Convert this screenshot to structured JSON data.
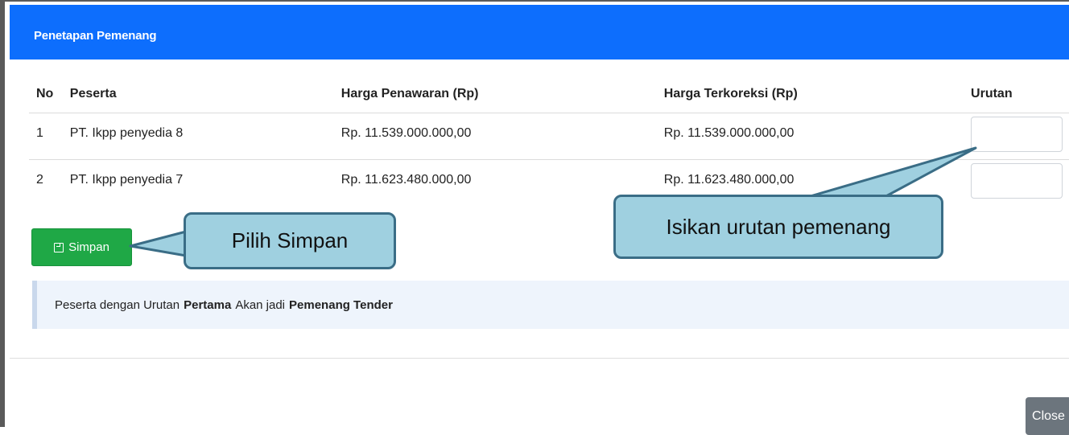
{
  "modal": {
    "title": "Penetapan Pemenang",
    "close_label": "Close"
  },
  "table": {
    "headers": {
      "no": "No",
      "peserta": "Peserta",
      "harga_penawaran": "Harga Penawaran (Rp)",
      "harga_terkoreksi": "Harga Terkoreksi (Rp)",
      "urutan": "Urutan"
    },
    "rows": [
      {
        "no": "1",
        "peserta": "PT. Ikpp penyedia 8",
        "harga_penawaran": "Rp. 11.539.000.000,00",
        "harga_terkoreksi": "Rp. 11.539.000.000,00",
        "urutan": ""
      },
      {
        "no": "2",
        "peserta": "PT. Ikpp penyedia 7",
        "harga_penawaran": "Rp. 11.623.480.000,00",
        "harga_terkoreksi": "Rp. 11.623.480.000,00",
        "urutan": ""
      }
    ]
  },
  "actions": {
    "simpan_label": "Simpan",
    "simpan_icon": "save-icon"
  },
  "info": {
    "part1": "Peserta dengan Urutan",
    "bold1": "Pertama",
    "part2": "Akan jadi",
    "bold2": "Pemenang Tender"
  },
  "callouts": {
    "simpan": "Pilih Simpan",
    "urutan": "Isikan urutan pemenang"
  },
  "colors": {
    "header_blue": "#0d6efd",
    "save_green": "#1fa846",
    "close_gray": "#6c757d",
    "callout_fill": "#9fd0e0",
    "callout_border": "#3a6d86",
    "info_bg": "#eef4fc"
  }
}
